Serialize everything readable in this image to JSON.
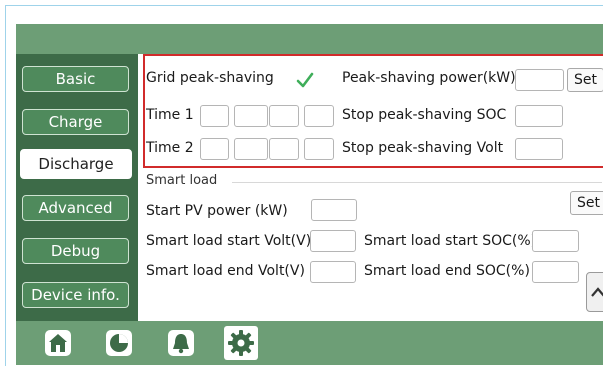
{
  "sidebar": {
    "items": [
      {
        "label": "Basic",
        "active": false
      },
      {
        "label": "Charge",
        "active": false
      },
      {
        "label": "Discharge",
        "active": true
      },
      {
        "label": "Advanced",
        "active": false
      },
      {
        "label": "Debug",
        "active": false
      },
      {
        "label": "Device info.",
        "active": false
      }
    ]
  },
  "peak": {
    "grid_label": "Grid peak-shaving",
    "grid_checked": true,
    "power_label": "Peak-shaving power(kW)",
    "power_value": "",
    "set_label": "Set",
    "time1_label": "Time 1",
    "time2_label": "Time 2",
    "stop_soc_label": "Stop peak-shaving SOC",
    "stop_soc_value": "",
    "stop_volt_label": "Stop peak-shaving Volt",
    "stop_volt_value": ""
  },
  "smart": {
    "section_label": "Smart load",
    "start_pv_label": "Start PV power (kW)",
    "start_pv_value": "",
    "set_label": "Set",
    "start_volt_label": "Smart load start Volt(V)",
    "start_volt_value": "",
    "start_soc_label": "Smart load start SOC(%)",
    "start_soc_value": "",
    "end_volt_label": "Smart load end Volt(V)",
    "end_volt_value": "",
    "end_soc_label": "Smart load end SOC(%)",
    "end_soc_value": ""
  },
  "bottom_nav": [
    {
      "icon": "home-icon",
      "active": false
    },
    {
      "icon": "pie-chart-icon",
      "active": false
    },
    {
      "icon": "bell-icon",
      "active": false
    },
    {
      "icon": "gear-icon",
      "active": true
    }
  ],
  "colors": {
    "bar": "#6d9e76",
    "sidebar": "#3d6b48",
    "button": "#4f8a5c",
    "highlight": "#d12b2b",
    "check": "#3fae5a"
  }
}
